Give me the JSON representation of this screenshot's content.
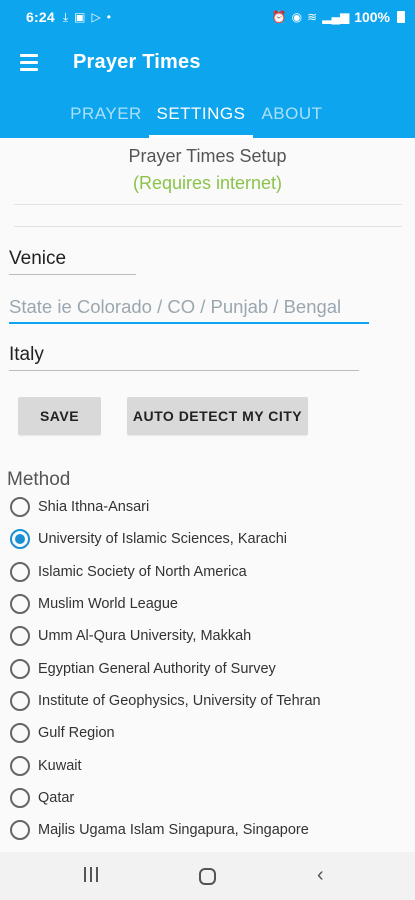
{
  "statusbar": {
    "time": "6:24",
    "left_icons": [
      "download-icon",
      "image-icon",
      "play-icon",
      "dot-icon"
    ],
    "right_icons": [
      "alarm-icon",
      "hotspot-icon",
      "volte-icon",
      "signal-icon"
    ],
    "battery": "100%"
  },
  "appbar": {
    "title": "Prayer Times",
    "menu_icon": "hamburger-menu-icon"
  },
  "tabs": [
    {
      "label": "PRAYER",
      "active": false
    },
    {
      "label": "SETTINGS",
      "active": true
    },
    {
      "label": "ABOUT",
      "active": false
    }
  ],
  "setup": {
    "title": "Prayer Times Setup",
    "note": "(Requires internet)"
  },
  "form": {
    "city_value": "Venice",
    "state_placeholder": "State ie Colorado / CO / Punjab / Bengal",
    "country_value": "Italy",
    "save_label": "SAVE",
    "auto_detect_label": "AUTO DETECT MY CITY"
  },
  "method": {
    "label": "Method",
    "selected_index": 1,
    "options": [
      "Shia Ithna-Ansari",
      "University of Islamic Sciences, Karachi",
      "Islamic Society of North America",
      "Muslim World League",
      "Umm Al-Qura University, Makkah",
      "Egyptian General Authority of Survey",
      "Institute of Geophysics, University of Tehran",
      "Gulf Region",
      "Kuwait",
      "Qatar",
      "Majlis Ugama Islam Singapura, Singapore"
    ]
  },
  "colors": {
    "primary": "#0ea5ef",
    "accent_green": "#8bc34a",
    "radio_selected": "#1a8fd6"
  },
  "navbar": {
    "icons": [
      "recent-apps-icon",
      "home-icon",
      "back-icon"
    ]
  }
}
